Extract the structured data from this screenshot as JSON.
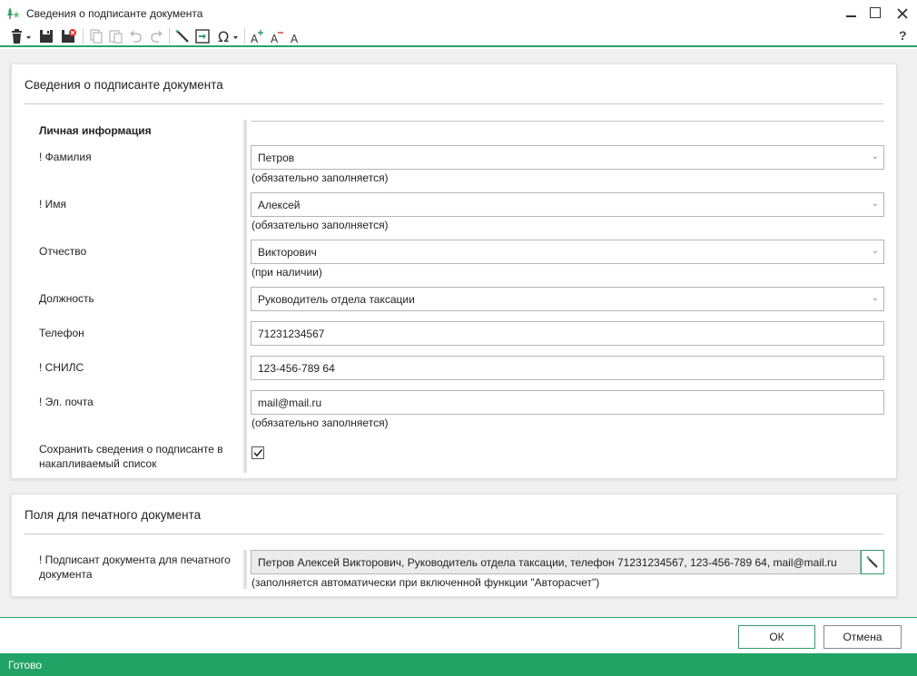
{
  "window": {
    "title": "Сведения о подписанте документа",
    "help": "?"
  },
  "panel1": {
    "title": "Сведения о подписанте документа",
    "section_label": "Личная информация",
    "fields": {
      "last_name": {
        "label": "! Фамилия",
        "value": "Петров",
        "hint": "(обязательно заполняется)"
      },
      "first_name": {
        "label": "! Имя",
        "value": "Алексей",
        "hint": "(обязательно заполняется)"
      },
      "middle_name": {
        "label": "Отчество",
        "value": "Викторович",
        "hint": "(при наличии)"
      },
      "position": {
        "label": "Должность",
        "value": "Руководитель отдела таксации"
      },
      "phone": {
        "label": "Телефон",
        "value": "71231234567"
      },
      "snils": {
        "label": "! СНИЛС",
        "value": "123-456-789 64"
      },
      "email": {
        "label": "! Эл. почта",
        "value": "mail@mail.ru",
        "hint": "(обязательно заполняется)"
      }
    },
    "save_checkbox": {
      "label_line1": "Сохранить сведения о подписанте в",
      "label_line2": "накапливаемый список",
      "checked": true
    }
  },
  "panel2": {
    "title": "Поля для печатного документа",
    "signer_label_line1": "! Подписант документа для печатного",
    "signer_label_line2": "документа",
    "signer_value": "Петров Алексей Викторович, Руководитель отдела таксации, телефон 71231234567, 123-456-789 64, mail@mail.ru",
    "signer_hint": "(заполняется автоматически при включенной функции \"Авторасчет\")"
  },
  "footer": {
    "ok_label": "ОК",
    "cancel_label": "Отмена"
  },
  "status": {
    "text": "Готово"
  },
  "colors": {
    "accent": "#21a366",
    "panel_bg": "#ffffff",
    "content_bg": "#f0f0f0"
  }
}
